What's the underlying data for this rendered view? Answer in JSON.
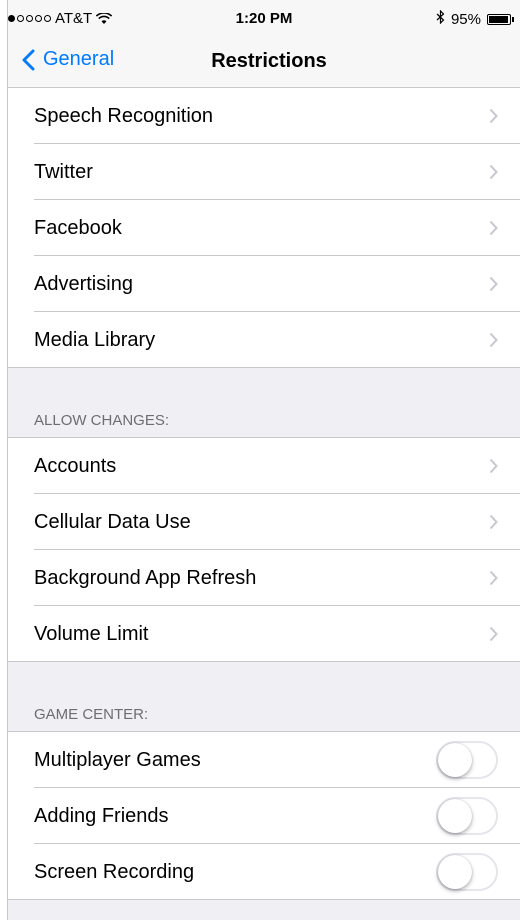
{
  "status_bar": {
    "signal_filled": 1,
    "signal_total": 5,
    "carrier": "AT&T",
    "time": "1:20 PM",
    "battery_percent": "95%",
    "battery_level": 0.95,
    "icons": [
      "wifi-icon",
      "bluetooth-icon",
      "battery-icon"
    ]
  },
  "nav": {
    "back_label": "General",
    "title": "Restrictions"
  },
  "sections": {
    "content": {
      "items": [
        "Speech Recognition",
        "Twitter",
        "Facebook",
        "Advertising",
        "Media Library"
      ]
    },
    "allow_changes": {
      "header": "ALLOW CHANGES:",
      "items": [
        "Accounts",
        "Cellular Data Use",
        "Background App Refresh",
        "Volume Limit"
      ]
    },
    "game_center": {
      "header": "GAME CENTER:",
      "items": [
        {
          "label": "Multiplayer Games",
          "on": false
        },
        {
          "label": "Adding Friends",
          "on": false
        },
        {
          "label": "Screen Recording",
          "on": false
        }
      ]
    }
  },
  "colors": {
    "accent": "#007aff",
    "background": "#efeff4",
    "separator": "#c8c7cc",
    "header_text": "#6d6d72",
    "chevron": "#c7c7cc"
  }
}
